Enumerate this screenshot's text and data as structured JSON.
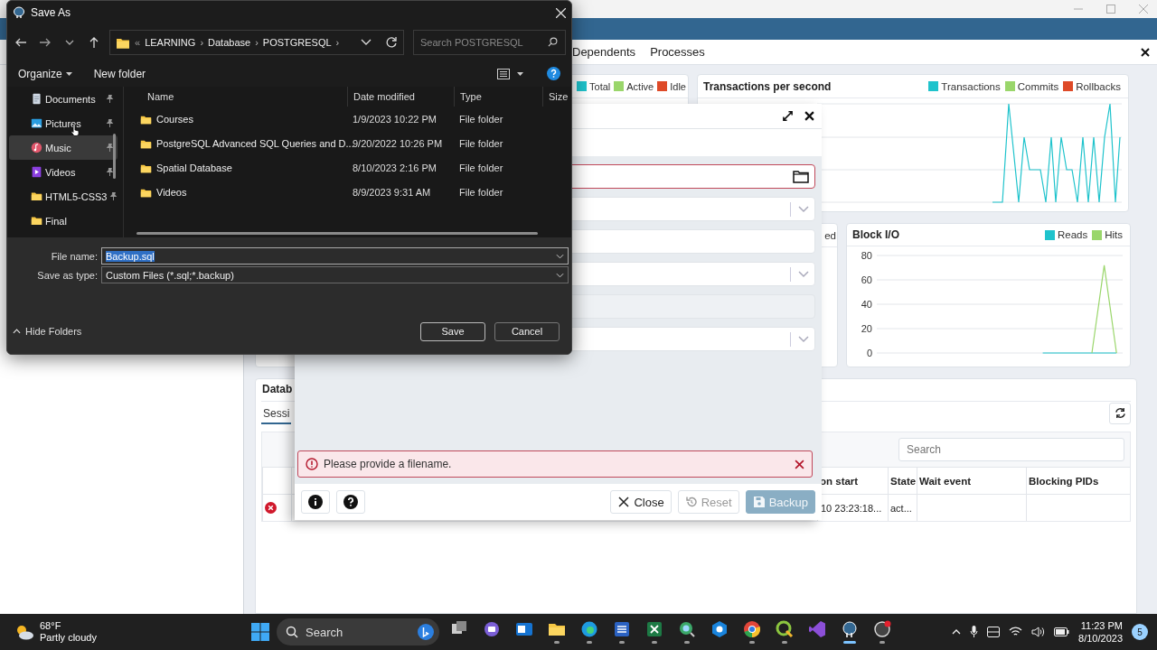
{
  "save_as": {
    "title": "Save As",
    "path": [
      {
        "kind": "overflow",
        "text": "«"
      },
      {
        "kind": "folder",
        "text": "LEARNING"
      },
      {
        "kind": "separator",
        "text": "›"
      },
      {
        "kind": "folder",
        "text": "Database"
      },
      {
        "kind": "separator",
        "text": "›"
      },
      {
        "kind": "folder",
        "text": "POSTGRESQL"
      },
      {
        "kind": "separator",
        "text": "›"
      }
    ],
    "search": {
      "placeholder": "Search POSTGRESQL"
    },
    "toolbar": [
      {
        "label": "Organize",
        "menu": true
      },
      {
        "label": "New folder",
        "menu": false
      }
    ],
    "sidebar": [
      {
        "label": "Documents",
        "kind": "documents",
        "pinned": true,
        "selected": false
      },
      {
        "label": "Pictures",
        "kind": "pictures",
        "pinned": true,
        "selected": false
      },
      {
        "label": "Music",
        "kind": "music",
        "pinned": true,
        "selected": true
      },
      {
        "label": "Videos",
        "kind": "videos",
        "pinned": true,
        "selected": false
      },
      {
        "label": "HTML5-CSS3",
        "kind": "folder",
        "pinned": true,
        "selected": false
      },
      {
        "label": "Final",
        "kind": "folder",
        "pinned": false,
        "selected": false
      }
    ],
    "columns": [
      "Name",
      "Date modified",
      "Type",
      "Size"
    ],
    "files": [
      {
        "name": "Courses",
        "date": "1/9/2023 10:22 PM",
        "type": "File folder"
      },
      {
        "name": "PostgreSQL Advanced SQL Queries and D...",
        "date": "9/20/2022 10:26 PM",
        "type": "File folder"
      },
      {
        "name": "Spatial Database",
        "date": "8/10/2023 2:16 PM",
        "type": "File folder"
      },
      {
        "name": "Videos",
        "date": "8/9/2023 9:31 AM",
        "type": "File folder"
      }
    ],
    "file_name": {
      "label": "File name:",
      "value": "Backup.sql"
    },
    "save_type": {
      "label": "Save as type:",
      "value": "Custom Files (*.sql;*.backup)"
    },
    "hide_folders": "Hide Folders",
    "buttons": [
      {
        "label": "Save",
        "default": true
      },
      {
        "label": "Cancel",
        "default": false
      }
    ]
  },
  "pgadmin": {
    "tabs": [
      "Dependents",
      "Processes"
    ],
    "sessions_chart": {
      "legend": [
        {
          "name": "Total",
          "color": "#1fc3cc"
        },
        {
          "name": "Active",
          "color": "#9ad66b"
        },
        {
          "name": "Idle",
          "color": "#de4a28"
        }
      ]
    },
    "transactions_chart": {
      "title": "Transactions per second",
      "legend": [
        {
          "name": "Transactions",
          "color": "#1fc3cc"
        },
        {
          "name": "Commits",
          "color": "#9ad66b"
        },
        {
          "name": "Rollbacks",
          "color": "#de4a28"
        }
      ]
    },
    "tuples_chart": {
      "legend_text": "ed"
    },
    "block_io": {
      "chart_data": {
        "type": "line",
        "title": "Block I/O",
        "grid": true,
        "ylim": [
          0,
          80
        ],
        "yticks": [
          0,
          20,
          40,
          60,
          80
        ],
        "series": [
          {
            "name": "Reads",
            "color": "#1fc3cc",
            "values": [
              null,
              null,
              null,
              null,
              null,
              null,
              null,
              null,
              null,
              null,
              null,
              null,
              null,
              0,
              0,
              0,
              0,
              0,
              0,
              0
            ]
          },
          {
            "name": "Hits",
            "color": "#9ad66b",
            "values": [
              null,
              null,
              null,
              null,
              null,
              null,
              null,
              null,
              null,
              null,
              null,
              null,
              null,
              null,
              null,
              null,
              null,
              0,
              72,
              0
            ]
          }
        ]
      }
    },
    "activity": {
      "title": "Datab",
      "tabs": [
        {
          "label": "Sessi",
          "selected": true
        }
      ],
      "search": {
        "placeholder": "Search"
      },
      "columns": [
        "on start",
        "State",
        "Wait event",
        "Blocking PIDs"
      ],
      "rows": [
        {
          "failed": true,
          "session_start": "10 23:23:18...",
          "state": "act..."
        }
      ]
    },
    "backup_dialog": {
      "fields": [
        {
          "kind": "file",
          "invalid": true
        },
        {
          "kind": "select",
          "invalid": false
        },
        {
          "kind": "input",
          "invalid": false
        },
        {
          "kind": "select",
          "invalid": false
        },
        {
          "kind": "input",
          "invalid": false,
          "disabled": true
        },
        {
          "kind": "select",
          "invalid": false
        }
      ],
      "error": "Please provide a filename.",
      "buttons": [
        {
          "kind": "close",
          "label": "Close",
          "disabled": false
        },
        {
          "kind": "reset",
          "label": "Reset",
          "disabled": true
        },
        {
          "kind": "backup",
          "label": "Backup",
          "disabled": true
        }
      ]
    }
  },
  "taskbar": {
    "weather": {
      "temperature": "68°F",
      "condition": "Partly cloudy"
    },
    "search": {
      "placeholder": "Search"
    },
    "apps": [
      {
        "kind": "taskview",
        "running": false
      },
      {
        "kind": "chat",
        "running": false
      },
      {
        "kind": "mail",
        "running": false
      },
      {
        "kind": "explorer",
        "running": true
      },
      {
        "kind": "edge",
        "running": true
      },
      {
        "kind": "word",
        "running": true
      },
      {
        "kind": "excel",
        "running": true
      },
      {
        "kind": "globe",
        "running": true
      },
      {
        "kind": "hex",
        "running": false
      },
      {
        "kind": "chrome",
        "running": true
      },
      {
        "kind": "qgis",
        "running": true
      },
      {
        "kind": "studio",
        "running": false
      },
      {
        "kind": "elephant",
        "running": true
      },
      {
        "kind": "record",
        "running": true
      }
    ],
    "clock": {
      "time": "11:23 PM",
      "date": "8/10/2023"
    },
    "notifications": "5"
  }
}
